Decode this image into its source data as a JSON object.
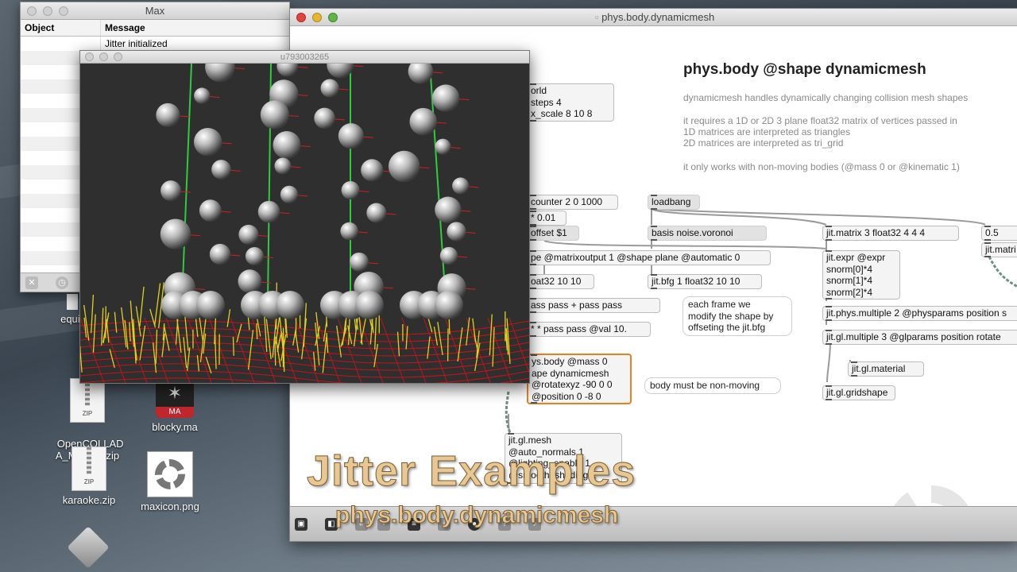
{
  "console": {
    "title": "Max",
    "col_object": "Object",
    "col_message": "Message",
    "rows": [
      {
        "object": "",
        "message": "Jitter initialized"
      },
      {
        "object": "",
        "message": ""
      },
      {
        "object": "",
        "message": ""
      },
      {
        "object": "",
        "message": ""
      },
      {
        "object": "",
        "message": ""
      },
      {
        "object": "",
        "message": ""
      },
      {
        "object": "",
        "message": ""
      },
      {
        "object": "",
        "message": ""
      },
      {
        "object": "",
        "message": ""
      },
      {
        "object": "",
        "message": ""
      },
      {
        "object": "",
        "message": ""
      },
      {
        "object": "",
        "message": ""
      },
      {
        "object": "",
        "message": ""
      },
      {
        "object": "",
        "message": ""
      },
      {
        "object": "",
        "message": ""
      },
      {
        "object": "",
        "message": ""
      }
    ]
  },
  "render_window": {
    "title": "u793003265"
  },
  "patcher": {
    "title": "phys.body.dynamicmesh",
    "heading": "phys.body @shape dynamicmesh",
    "desc_1": "dynamicmesh handles dynamically changing collision mesh shapes",
    "desc_2": "it requires a 1D or 2D 3 plane float32 matrix of vertices passed in",
    "desc_3": "1D matrices are interpreted as triangles",
    "desc_4": "2D matrices are interpreted as tri_grid",
    "desc_5": "it only works with non-moving bodies (@mass 0 or @kinematic 1)",
    "objects": {
      "world": "orld\nsteps 4\nx_scale 8 10 8",
      "counter": "counter 2 0 1000",
      "loadbang": "loadbang",
      "mult": "* 0.01",
      "offset": "offset $1",
      "basis": "basis noise.voronoi",
      "jitmatrix": "jit.matrix 3 float32 4 4 4",
      "val05": "0.5",
      "jitmatri_r": "jit.matri",
      "shape": "pe @matrixoutput 1 @shape plane @automatic 0",
      "float32": "oat32 10 10",
      "bfg": "jit.bfg 1 float32 10 10",
      "expr": "jit.expr @expr\nsnorm[0]*4\nsnorm[1]*4\nsnorm[2]*4",
      "passpass": "ass pass + pass pass",
      "physmult": "jit.phys.multiple 2 @physparams position s",
      "glmult": "jit.gl.multiple 3 @glparams position rotate",
      "valpass": "* * pass pass @val 10.",
      "material": "jit.gl.material",
      "body": "ys.body @mass 0\nape dynamicmesh\n@rotatexyz -90 0 0\n@position 0 -8 0",
      "gridshape": "jit.gl.gridshape",
      "mesh": "jit.gl.mesh\n@auto_normals 1\n@lighting_enable 1\n@smooth_shading 1"
    },
    "comments": {
      "eachframe": "each frame we\nmodify the shape by\noffseting the jit.bfg",
      "nonmoving": "body must be non-moving"
    }
  },
  "desktop": {
    "icons": [
      {
        "name": "equip"
      },
      {
        "name": "OpenCOLLAD\nA_Ma…sx.zip"
      },
      {
        "name": "blocky.ma"
      },
      {
        "name": "karaoke.zip"
      },
      {
        "name": "maxicon.png"
      }
    ],
    "zip_badge": "ZIP",
    "ma_badge": "MA"
  },
  "caption": {
    "line1": "Jitter Examples",
    "line2": "phys.body.dynamicmesh"
  }
}
